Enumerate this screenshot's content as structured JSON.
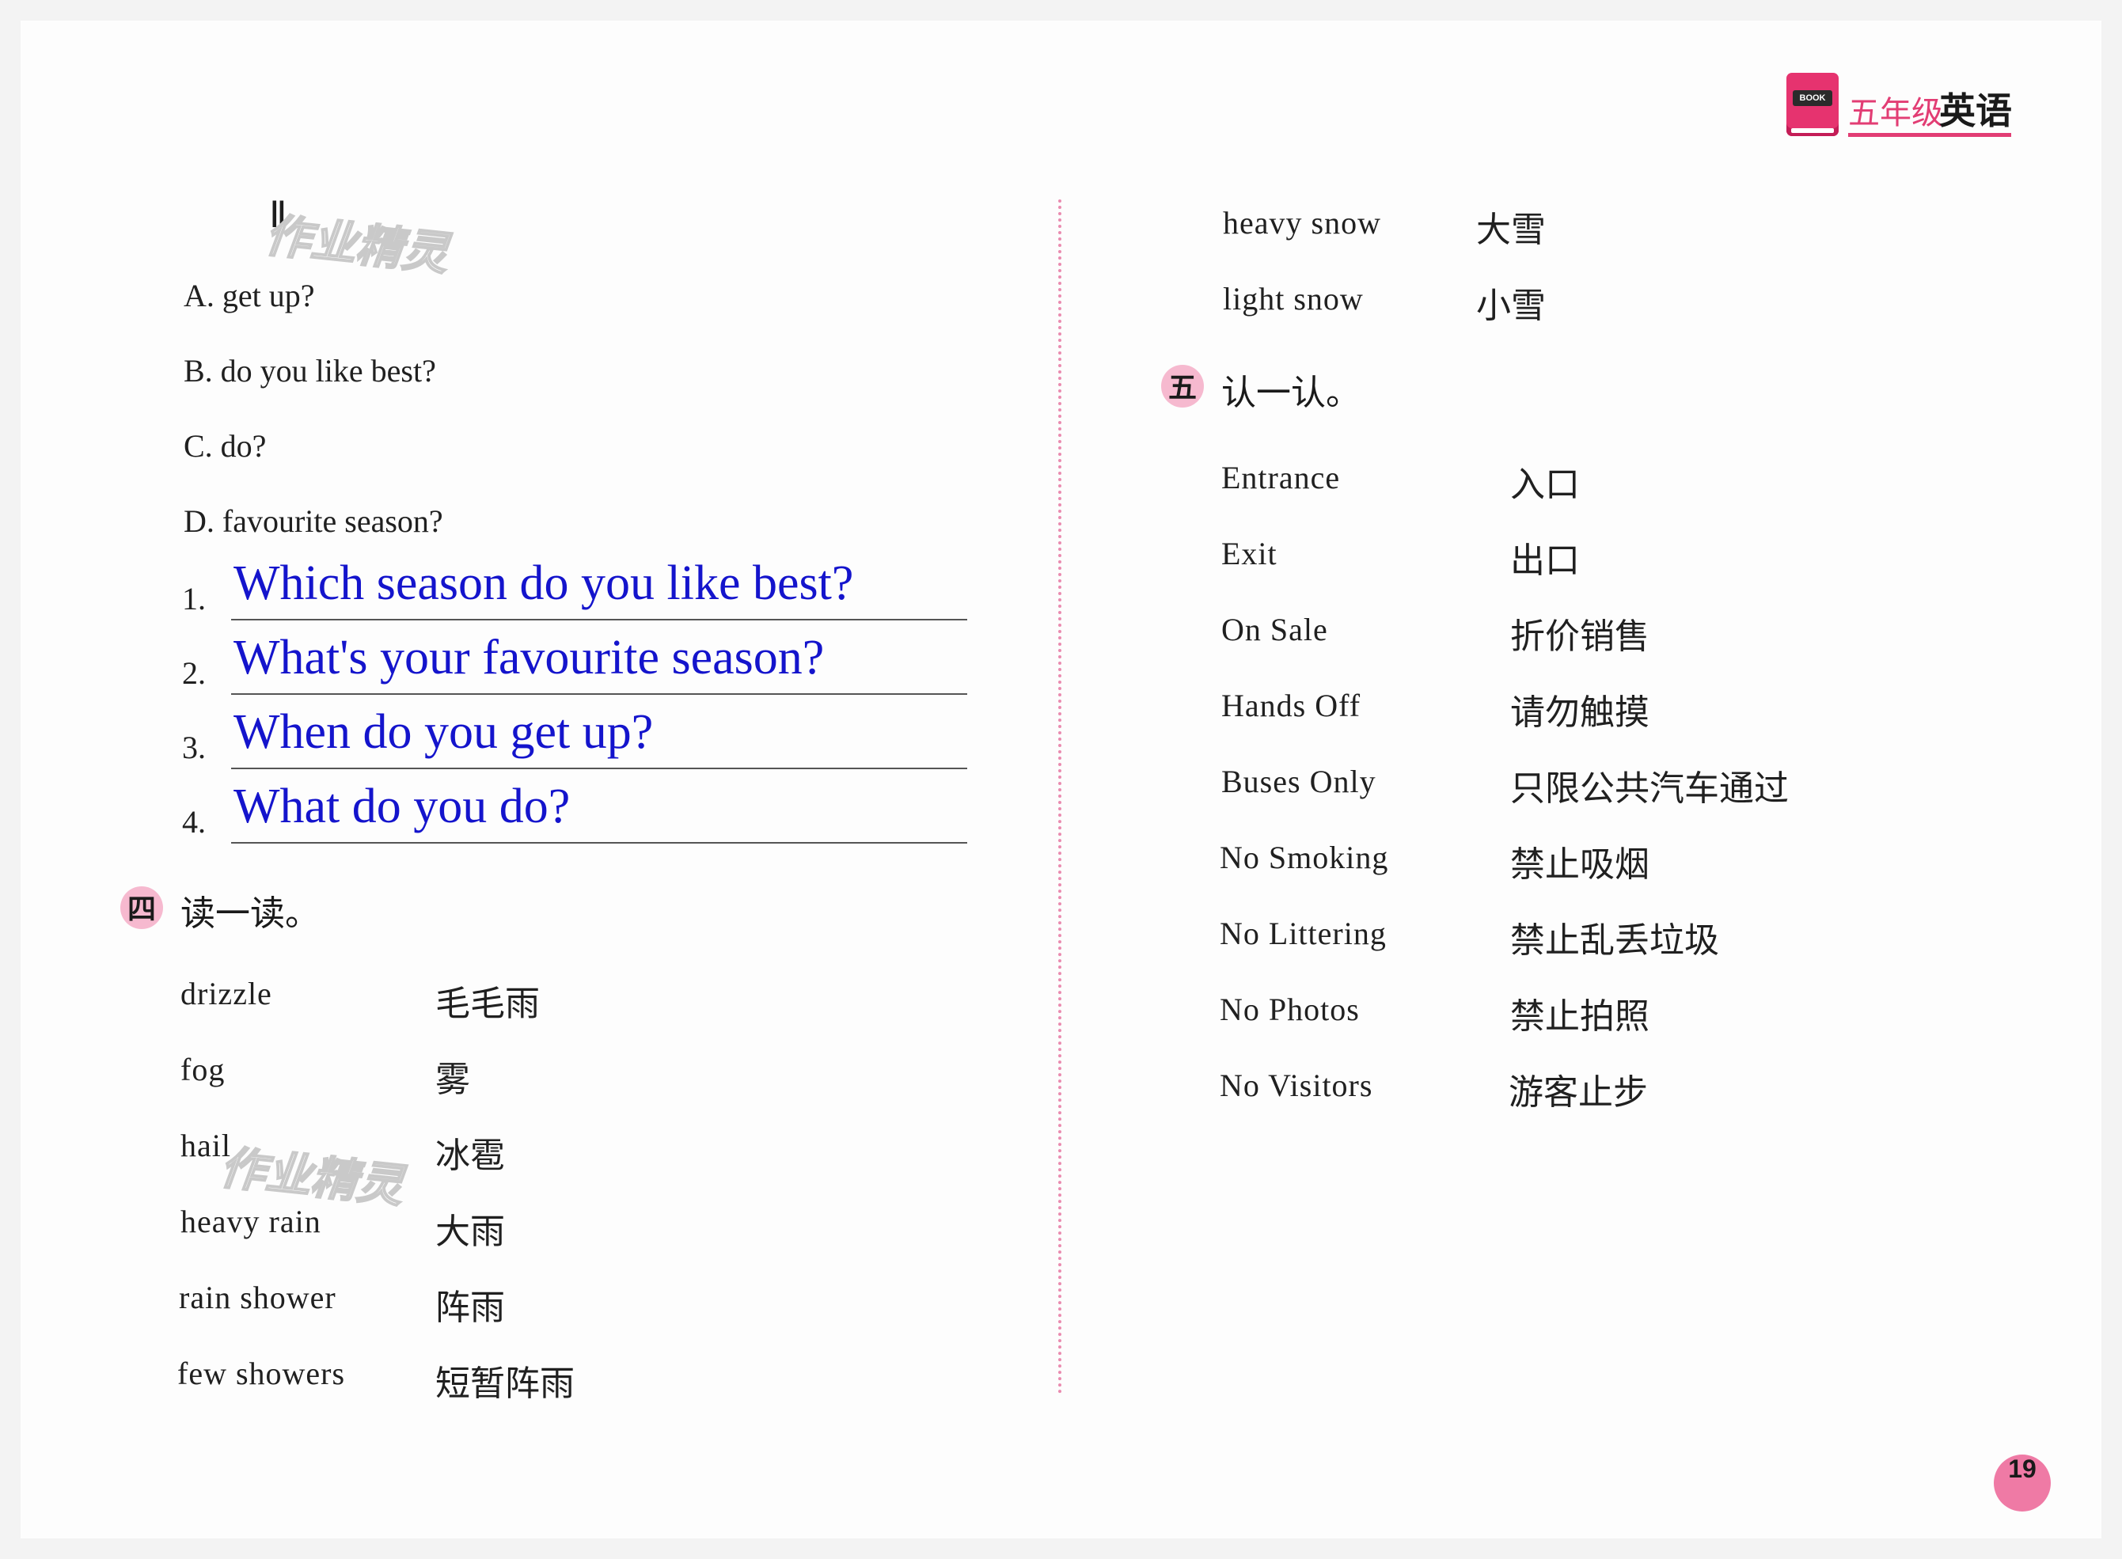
{
  "header": {
    "book_tag": "BOOK",
    "grade": "五年级",
    "subject": "英语"
  },
  "watermark": "作业精灵",
  "part2": {
    "roman": "Ⅱ",
    "options": [
      {
        "label": "A. get up?"
      },
      {
        "label": "B. do you like best?"
      },
      {
        "label": "C. do?"
      },
      {
        "label": "D. favourite season?"
      }
    ],
    "answers": [
      {
        "num": "1.",
        "text": "Which season do you like best?"
      },
      {
        "num": "2.",
        "text": "What's your favourite season?"
      },
      {
        "num": "3.",
        "text": "When do you get up?"
      },
      {
        "num": "4.",
        "text": "What do you do?"
      }
    ]
  },
  "section4": {
    "badge": "四",
    "title": "读一读。",
    "items": [
      {
        "en": "drizzle",
        "zh": "毛毛雨"
      },
      {
        "en": "fog",
        "zh": "雾"
      },
      {
        "en": "hail",
        "zh": "冰雹"
      },
      {
        "en": "heavy rain",
        "zh": "大雨"
      },
      {
        "en": "rain shower",
        "zh": "阵雨"
      },
      {
        "en": "few showers",
        "zh": "短暂阵雨"
      }
    ]
  },
  "section4_cont": {
    "items": [
      {
        "en": "heavy snow",
        "zh": "大雪"
      },
      {
        "en": "light snow",
        "zh": "小雪"
      }
    ]
  },
  "section5": {
    "badge": "五",
    "title": "认一认。",
    "items": [
      {
        "en": "Entrance",
        "zh": "入口"
      },
      {
        "en": "Exit",
        "zh": "出口"
      },
      {
        "en": "On Sale",
        "zh": "折价销售"
      },
      {
        "en": "Hands Off",
        "zh": "请勿触摸"
      },
      {
        "en": "Buses Only",
        "zh": "只限公共汽车通过"
      },
      {
        "en": "No Smoking",
        "zh": "禁止吸烟"
      },
      {
        "en": "No Littering",
        "zh": "禁止乱丢垃圾"
      },
      {
        "en": "No Photos",
        "zh": "禁止拍照"
      },
      {
        "en": "No Visitors",
        "zh": "游客止步"
      }
    ]
  },
  "page_number": "19"
}
